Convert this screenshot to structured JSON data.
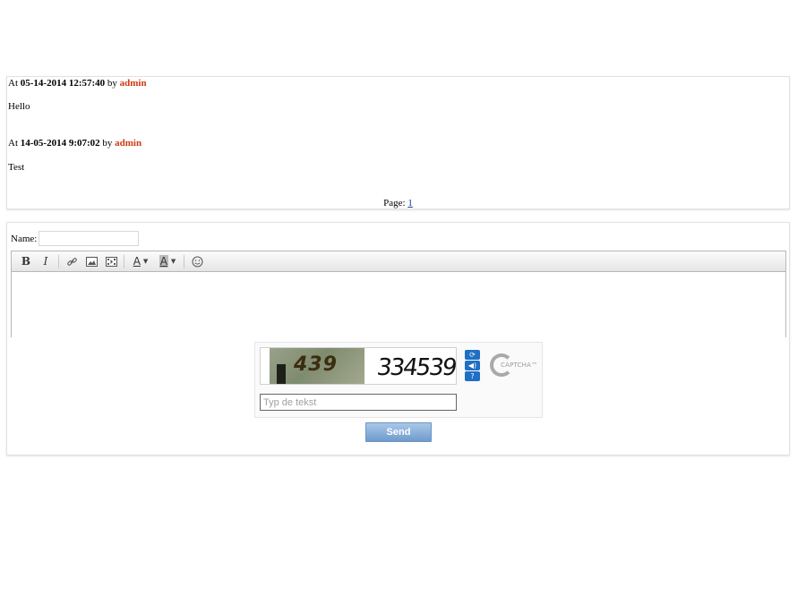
{
  "comments": [
    {
      "prefix": "At",
      "datetime": "05-14-2014 12:57:40",
      "by": "by",
      "author": "admin",
      "text": "Hello"
    },
    {
      "prefix": "At",
      "datetime": "14-05-2014 9:07:02",
      "by": "by",
      "author": "admin",
      "text": "Test"
    }
  ],
  "pagination": {
    "label": "Page:",
    "pages": [
      "1"
    ]
  },
  "form": {
    "name_label": "Name:",
    "name_value": ""
  },
  "toolbar": {
    "bold": "B",
    "italic": "I",
    "font_color": "A",
    "bg_color": "A"
  },
  "captcha": {
    "photo_text": "439",
    "word_text": "334539",
    "placeholder": "Typ de tekst",
    "logo_text": "CAPTCHA™",
    "icons": [
      "refresh-icon",
      "audio-icon",
      "help-icon"
    ]
  },
  "send_label": "Send",
  "colors": {
    "author": "#d03a12",
    "link": "#1a3a8a",
    "button": "#6f9bcc"
  }
}
